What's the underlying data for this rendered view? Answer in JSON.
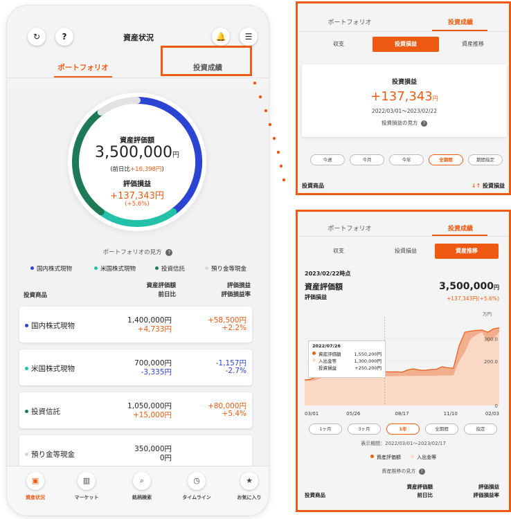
{
  "phone": {
    "header": {
      "title": "資産状況",
      "refresh_icon": "↻",
      "help_icon": "?",
      "bell_icon": "🔔",
      "menu_icon": "☰"
    },
    "tabs": [
      "ポートフォリオ",
      "投資成績"
    ],
    "summary": {
      "asset_label": "資産評価額",
      "asset_value": "3,500,000",
      "yen": "円",
      "day_change_prefix": "(前日比",
      "day_change": "+16,398円",
      "day_change_suffix": ")",
      "pl_label": "評価損益",
      "pl_value": "+137,343円",
      "pl_rate": "(+5.6%)"
    },
    "ring": [
      {
        "name": "国内株式現物",
        "value": 1400000,
        "color": "#2b44d2"
      },
      {
        "name": "米国株式現物",
        "value": 700000,
        "color": "#23c1a8"
      },
      {
        "name": "投資信託",
        "value": 1050000,
        "color": "#1e7a56"
      },
      {
        "name": "預り金等現金",
        "value": 350000,
        "color": "#e2e2e2"
      }
    ],
    "portfolio_help": "ポートフォリオの見方",
    "legend": [
      {
        "label": "国内株式現物",
        "color": "#2b44d2"
      },
      {
        "label": "米国株式現物",
        "color": "#23c1a8"
      },
      {
        "label": "投資信託",
        "color": "#1e7a56"
      },
      {
        "label": "預り金等現金",
        "color": "#d8d8d8"
      }
    ],
    "table_headers": {
      "product": "投資商品",
      "value_1": "資産評価額",
      "value_2": "前日比",
      "pl_1": "評価損益",
      "pl_2": "評価損益率"
    },
    "holdings": [
      {
        "name": "国内株式現物",
        "dot_color": "#2b44d2",
        "value": "1,400,000円",
        "day_change": "+4,733円",
        "day_dir": "pos",
        "pl": "+58,500円",
        "pl_dir": "pos",
        "pl_rate": "+2.2%",
        "rate_dir": "pos"
      },
      {
        "name": "米国株式現物",
        "dot_color": "#23c1a8",
        "value": "700,000円",
        "day_change": "-3,335円",
        "day_dir": "neg",
        "pl": "-1,157円",
        "pl_dir": "neg",
        "pl_rate": "-2.7%",
        "rate_dir": "neg"
      },
      {
        "name": "投資信託",
        "dot_color": "#1e7a56",
        "value": "1,050,000円",
        "day_change": "+15,000円",
        "day_dir": "pos",
        "pl": "+80,000円",
        "pl_dir": "pos",
        "pl_rate": "+5.4%",
        "rate_dir": "pos"
      },
      {
        "name": "預り金等現金",
        "dot_color": "#d8d8d8",
        "value": "350,000円",
        "day_change": "0円",
        "day_dir": "none",
        "pl": "",
        "pl_dir": "none",
        "pl_rate": "",
        "rate_dir": "none"
      }
    ],
    "nav": [
      {
        "label": "資産状況",
        "icon": "▣",
        "active": true
      },
      {
        "label": "マーケット",
        "icon": "▥",
        "active": false
      },
      {
        "label": "銘柄検索",
        "icon": "⌕",
        "active": false
      },
      {
        "label": "タイムライン",
        "icon": "◷",
        "active": false
      },
      {
        "label": "お気に入り",
        "icon": "★",
        "active": false
      }
    ]
  },
  "callout_top": {
    "tabs": [
      "ポートフォリオ",
      "投資成績"
    ],
    "segments": [
      "収支",
      "投資損益",
      "資産推移"
    ],
    "active_segment": 1,
    "card": {
      "title": "投資損益",
      "value": "+137,343",
      "yen": "円",
      "period": "2022/03/01〜2023/02/22",
      "help": "投資損益の見方"
    },
    "periods": [
      "今週",
      "今月",
      "今年",
      "全期間",
      "期間指定"
    ],
    "active_period": 3,
    "footer_left": "投資商品",
    "footer_right": "投資損益",
    "sort_icon": "↓↑"
  },
  "callout_bottom": {
    "tabs": [
      "ポートフォリオ",
      "投資成績"
    ],
    "segments": [
      "収支",
      "投資損益",
      "資産推移"
    ],
    "active_segment": 2,
    "as_of": "2023/02/22時点",
    "asset_label": "資産評価額",
    "asset_value": "3,500,000",
    "yen": "円",
    "pl_label": "評価損益",
    "pl_value": "+137,343円(+5.6%)",
    "tooltip": {
      "date": "2022/07/26",
      "rows": [
        {
          "label": "資産評価額",
          "value": "1,550,200円",
          "color": "#ee5a12"
        },
        {
          "label": "入出金等",
          "value": "1,300,000円",
          "color": "#fbd9c6"
        },
        {
          "label": "投資損益",
          "value": "+250,200円",
          "color": ""
        }
      ]
    },
    "ranges": [
      "1ヶ月",
      "3ヶ月",
      "1年",
      "全期間",
      "指定"
    ],
    "active_range": 2,
    "display_period": "表示期間：2022/03/01〜2023/02/17",
    "legend": [
      {
        "label": "資産評価額",
        "color": "#ee5a12"
      },
      {
        "label": "入出金等",
        "color": "#fbd9c6"
      }
    ],
    "help": "資産推移の見方",
    "table_headers": {
      "product": "投資商品",
      "value_1": "資産評価額",
      "value_2": "前日比",
      "pl_1": "評価損益",
      "pl_2": "評価損益率"
    }
  },
  "chart_data": {
    "type": "area",
    "unit": "万円",
    "y_ticks": [
      "300.0",
      "200.0",
      "0"
    ],
    "ylim": [
      0,
      380
    ],
    "x_ticks": [
      "03/01",
      "05/26",
      "08/17",
      "11/10",
      "02/03"
    ],
    "series": [
      {
        "name": "資産評価額",
        "color": "#ee5a12",
        "values": [
          115,
          118,
          130,
          150,
          145,
          148,
          146,
          150,
          155,
          152,
          155,
          158,
          156,
          153,
          152,
          151,
          152,
          150,
          160,
          165,
          160,
          158,
          162,
          163,
          175,
          170,
          168,
          270,
          330,
          335,
          338,
          340,
          330,
          345,
          350
        ]
      },
      {
        "name": "入出金等",
        "color": "#fbd9c6",
        "values": [
          110,
          111,
          115,
          125,
          126,
          127,
          128,
          129,
          130,
          130,
          131,
          131,
          132,
          132,
          132,
          132,
          132,
          133,
          133,
          133,
          134,
          134,
          134,
          134,
          135,
          135,
          136,
          200,
          240,
          300,
          318,
          330,
          285,
          300,
          330
        ]
      }
    ],
    "cursor_index": 14
  }
}
